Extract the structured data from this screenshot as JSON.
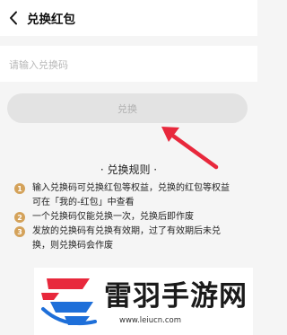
{
  "header": {
    "title": "兑换红包",
    "back_icon": "back-arrow-icon"
  },
  "input": {
    "placeholder": "请输入兑换码",
    "value": ""
  },
  "button": {
    "label": "兑换"
  },
  "rules": {
    "title": "· 兑换规则 ·",
    "items": [
      {
        "num": "1",
        "lines": [
          "输入兑换码可兑换红包等权益，兑换的红包等权益",
          "可在「我的-红包」中查看"
        ]
      },
      {
        "num": "2",
        "lines": [
          "一个兑换码仅能兑换一次，兑换后即作废"
        ]
      },
      {
        "num": "3",
        "lines": [
          "发放的兑换码有兑换有效期，过了有效期后未兑",
          "换，则兑换码会作废"
        ]
      }
    ]
  },
  "watermark": {
    "name": "雷羽手游网",
    "url": "www.leiucn.com"
  },
  "colors": {
    "arrow": "#e8283c",
    "badge": "#d4a25a",
    "logo_red": "#e8283c",
    "logo_blue": "#1e6fd9"
  }
}
